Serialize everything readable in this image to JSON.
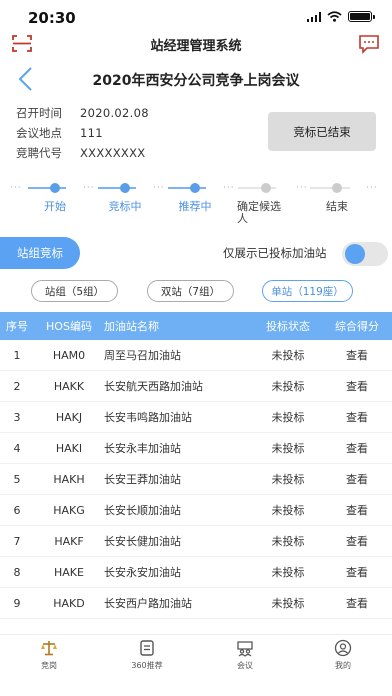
{
  "status_bar": {
    "time": "20:30"
  },
  "nav": {
    "title": "站经理管理系统"
  },
  "meeting": {
    "title": "2020年西安分公司竞争上岗会议",
    "info": [
      {
        "label": "召开时间",
        "value": "2020.02.08"
      },
      {
        "label": "会议地点",
        "value": "111"
      },
      {
        "label": "竞聘代号",
        "value": "XXXXXXXX"
      }
    ],
    "status_button": "竞标已结束"
  },
  "steps": [
    {
      "label": "开始",
      "state": "done"
    },
    {
      "label": "竞标中",
      "state": "done"
    },
    {
      "label": "推荐中",
      "state": "done"
    },
    {
      "label": "确定候选人",
      "state": "pending"
    },
    {
      "label": "结束",
      "state": "pending"
    }
  ],
  "filters": {
    "zone_button": "站组竞标",
    "toggle_label": "仅展示已投标加油站",
    "toggle_on": true,
    "chips": [
      {
        "label": "站组（5组）",
        "active": false
      },
      {
        "label": "双站（7组）",
        "active": false
      },
      {
        "label": "单站（119座）",
        "active": true
      }
    ]
  },
  "table": {
    "columns": [
      "序号",
      "HOS编码",
      "加油站名称",
      "投标状态",
      "综合得分"
    ],
    "rows": [
      [
        "1",
        "HAM0",
        "周至马召加油站",
        "未投标",
        "查看"
      ],
      [
        "2",
        "HAKK",
        "长安航天西路加油站",
        "未投标",
        "查看"
      ],
      [
        "3",
        "HAKJ",
        "长安韦鸣路加油站",
        "未投标",
        "查看"
      ],
      [
        "4",
        "HAKI",
        "长安永丰加油站",
        "未投标",
        "查看"
      ],
      [
        "5",
        "HAKH",
        "长安王莽加油站",
        "未投标",
        "查看"
      ],
      [
        "6",
        "HAKG",
        "长安长顺加油站",
        "未投标",
        "查看"
      ],
      [
        "7",
        "HAKF",
        "长安长健加油站",
        "未投标",
        "查看"
      ],
      [
        "8",
        "HAKE",
        "长安永安加油站",
        "未投标",
        "查看"
      ],
      [
        "9",
        "HAKD",
        "长安西户路加油站",
        "未投标",
        "查看"
      ]
    ]
  },
  "tabbar": [
    {
      "label": "竞岗",
      "icon": "scale-icon"
    },
    {
      "label": "360推荐",
      "icon": "document-icon"
    },
    {
      "label": "会议",
      "icon": "meeting-icon"
    },
    {
      "label": "我的",
      "icon": "profile-icon"
    }
  ],
  "colors": {
    "accent": "#5ba2f2",
    "header_row": "#6fb0f5",
    "disabled_button": "#dcdcdc"
  }
}
